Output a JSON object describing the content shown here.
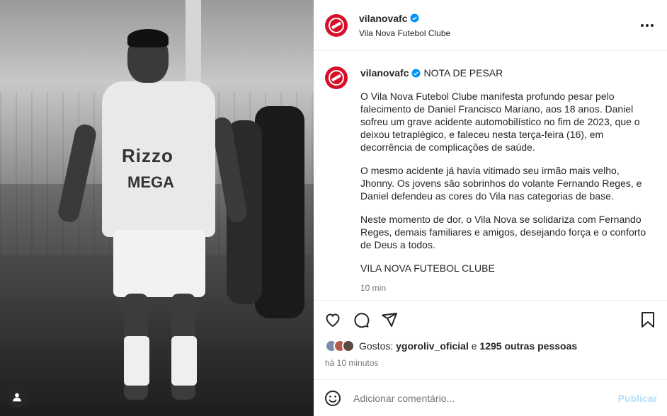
{
  "post": {
    "author": {
      "username": "vilanovafc",
      "full_name": "Vila Nova Futebol Clube",
      "verified": true
    },
    "image": {
      "jersey_texts": [
        "Rizzo",
        "MEGA"
      ]
    },
    "caption": {
      "title": "NOTA DE PESAR",
      "paragraphs": [
        "O Vila Nova Futebol Clube manifesta profundo pesar pelo falecimento de Daniel Francisco Mariano, aos 18 anos. Daniel sofreu um grave acidente automobilístico no fim de 2023, que o deixou tetraplégico, e faleceu nesta terça-feira (16), em decorrência de complicações de saúde.",
        "O mesmo acidente já havia vitimado seu irmão mais velho, Jhonny. Os jovens são sobrinhos do volante Fernando Reges, e Daniel defendeu as cores do Vila nas categorias de base.",
        "Neste momento de dor, o Vila Nova se solidariza com Fernando Reges, demais familiares e amigos, desejando força e o conforto de Deus a todos.",
        "VILA NOVA FUTEBOL CLUBE"
      ],
      "time": "10 min"
    },
    "likes": {
      "prefix": "Gostos:",
      "first_user": "ygoroliv_oficial",
      "connector": "e",
      "others": "1295 outras pessoas"
    },
    "posted_ago": "há 10 minutos"
  },
  "comment_box": {
    "placeholder": "Adicionar comentário...",
    "publish_label": "Publicar"
  },
  "icons": [
    "more-icon",
    "heart-icon",
    "comment-icon",
    "share-icon",
    "bookmark-icon",
    "emoji-icon",
    "user-tag-icon",
    "verified-icon"
  ],
  "colors": {
    "brand_red": "#d7102a",
    "verified_blue": "#0095f6",
    "publish_disabled": "#b2dffc"
  }
}
